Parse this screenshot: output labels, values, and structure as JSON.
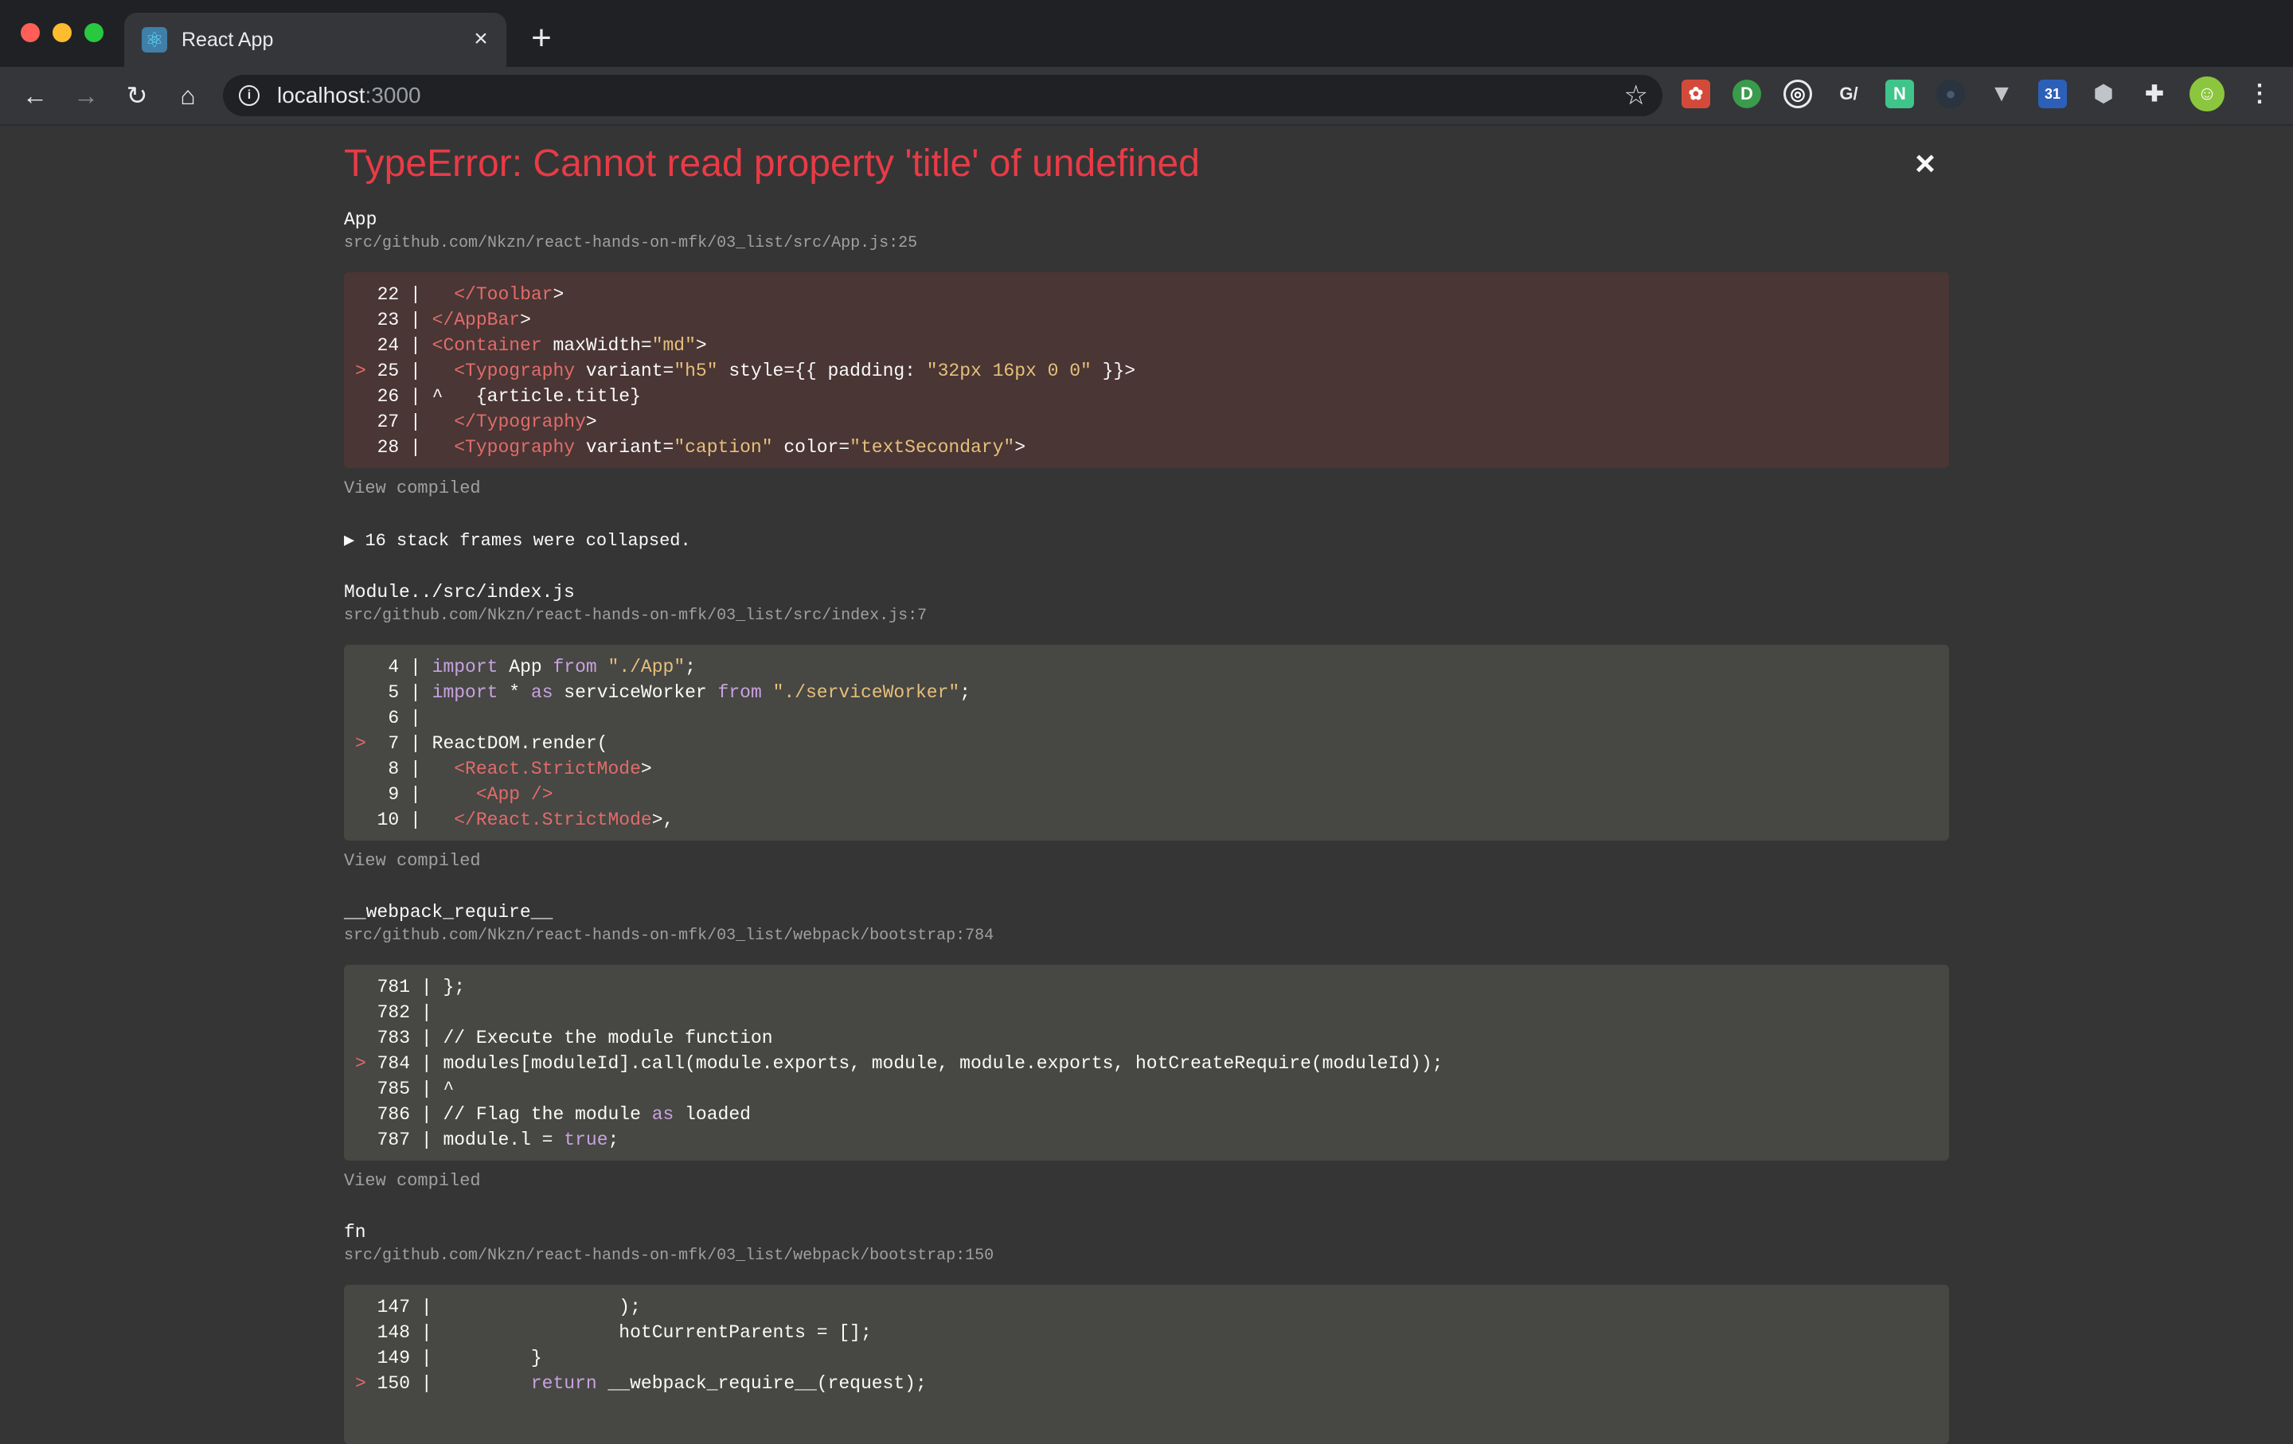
{
  "browser": {
    "tab_title": "React App",
    "tab_favicon": "react-logo-icon",
    "new_tab_symbol": "+",
    "url_host": "localhost",
    "url_port": ":3000",
    "extensions": [
      "ext-red-icon",
      "ext-green-d-icon",
      "ext-target-icon",
      "ext-g-icon",
      "ext-notion-n-icon",
      "ext-dark-circle-icon",
      "ext-v-icon",
      "ext-calendar-icon",
      "ext-cube-icon",
      "puzzle-icon",
      "profile-avatar-icon",
      "menu-kebab-icon"
    ]
  },
  "overlay": {
    "error_title": "TypeError: Cannot read property 'title' of undefined",
    "close_symbol": "×",
    "view_compiled": "View compiled",
    "collapsed_text": "▶ 16 stack frames were collapsed.",
    "frames": [
      {
        "fn": "App",
        "loc": "src/github.com/Nkzn/react-hands-on-mfk/03_list/src/App.js:25",
        "highlighted": true,
        "lines": [
          {
            "mark": " ",
            "no": "22",
            "code": "  </Toolbar>"
          },
          {
            "mark": " ",
            "no": "23",
            "code": "</AppBar>"
          },
          {
            "mark": " ",
            "no": "24",
            "code": "<Container maxWidth=\"md\">"
          },
          {
            "mark": ">",
            "no": "25",
            "code": "  <Typography variant=\"h5\" style={{ padding: \"32px 16px 0 0\" }}>"
          },
          {
            "mark": " ",
            "no": "26",
            "code": "^   {article.title}"
          },
          {
            "mark": " ",
            "no": "27",
            "code": "  </Typography>"
          },
          {
            "mark": " ",
            "no": "28",
            "code": "  <Typography variant=\"caption\" color=\"textSecondary\">"
          }
        ]
      },
      {
        "fn": "Module../src/index.js",
        "loc": "src/github.com/Nkzn/react-hands-on-mfk/03_list/src/index.js:7",
        "highlighted": false,
        "lines": [
          {
            "mark": " ",
            "no": "4",
            "code": "import App from \"./App\";"
          },
          {
            "mark": " ",
            "no": "5",
            "code": "import * as serviceWorker from \"./serviceWorker\";"
          },
          {
            "mark": " ",
            "no": "6",
            "code": ""
          },
          {
            "mark": ">",
            "no": "7",
            "code": "ReactDOM.render("
          },
          {
            "mark": " ",
            "no": "8",
            "code": "  <React.StrictMode>"
          },
          {
            "mark": " ",
            "no": "9",
            "code": "    <App />"
          },
          {
            "mark": " ",
            "no": "10",
            "code": "  </React.StrictMode>,"
          }
        ]
      },
      {
        "fn": "__webpack_require__",
        "loc": "src/github.com/Nkzn/react-hands-on-mfk/03_list/webpack/bootstrap:784",
        "highlighted": false,
        "lines": [
          {
            "mark": " ",
            "no": "781",
            "code": "};"
          },
          {
            "mark": " ",
            "no": "782",
            "code": ""
          },
          {
            "mark": " ",
            "no": "783",
            "code": "// Execute the module function"
          },
          {
            "mark": ">",
            "no": "784",
            "code": "modules[moduleId].call(module.exports, module, module.exports, hotCreateRequire(moduleId));"
          },
          {
            "mark": " ",
            "no": "785",
            "code": "^"
          },
          {
            "mark": " ",
            "no": "786",
            "code": "// Flag the module as loaded"
          },
          {
            "mark": " ",
            "no": "787",
            "code": "module.l = true;"
          }
        ]
      },
      {
        "fn": "fn",
        "loc": "src/github.com/Nkzn/react-hands-on-mfk/03_list/webpack/bootstrap:150",
        "highlighted": false,
        "lines": [
          {
            "mark": " ",
            "no": "147",
            "code": "                );"
          },
          {
            "mark": " ",
            "no": "148",
            "code": "                hotCurrentParents = [];"
          },
          {
            "mark": " ",
            "no": "149",
            "code": "        }"
          },
          {
            "mark": ">",
            "no": "150",
            "code": "        return __webpack_require__(request);"
          }
        ]
      }
    ]
  }
}
